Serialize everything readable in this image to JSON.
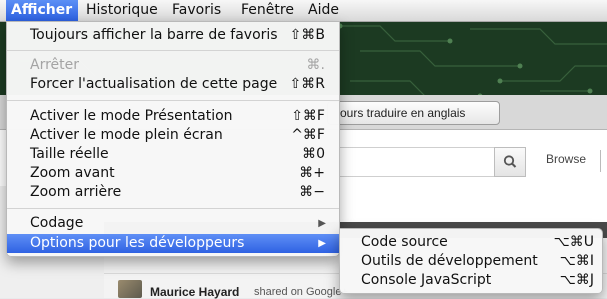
{
  "menubar": {
    "items": [
      {
        "label": "Afficher",
        "active": true
      },
      {
        "label": "Historique"
      },
      {
        "label": "Favoris"
      },
      {
        "label": "Fenêtre"
      },
      {
        "label": "Aide"
      }
    ]
  },
  "menu": {
    "items": [
      {
        "label": "Toujours afficher la barre de favoris",
        "shortcut": "⇧⌘B"
      },
      {
        "label": "Arrêter",
        "shortcut": "⌘.",
        "disabled": true
      },
      {
        "label": "Forcer l'actualisation de cette page",
        "shortcut": "⇧⌘R"
      },
      {
        "label": "Activer le mode Présentation",
        "shortcut": "⇧⌘F"
      },
      {
        "label": "Activer le mode plein écran",
        "shortcut": "^⌘F"
      },
      {
        "label": "Taille réelle",
        "shortcut": "⌘0"
      },
      {
        "label": "Zoom avant",
        "shortcut": "⌘+"
      },
      {
        "label": "Zoom arrière",
        "shortcut": "⌘−"
      },
      {
        "label": "Codage",
        "submenu_arrow": "▶"
      },
      {
        "label": "Options pour les développeurs",
        "submenu_arrow": "▶",
        "highlighted": true
      }
    ]
  },
  "submenu": {
    "items": [
      {
        "label": "Code source",
        "shortcut": "⌥⌘U"
      },
      {
        "label": "Outils de développement",
        "shortcut": "⌥⌘I"
      },
      {
        "label": "Console JavaScript",
        "shortcut": "⌥⌘J"
      }
    ]
  },
  "page": {
    "translate_button": "ours traduire en anglais",
    "browse_link": "Browse",
    "feed_author": "Maurice Hayard",
    "feed_meta": "shared on Google+"
  },
  "colors": {
    "highlight": "#2f62e3",
    "header_bg": "#1c3a22"
  }
}
